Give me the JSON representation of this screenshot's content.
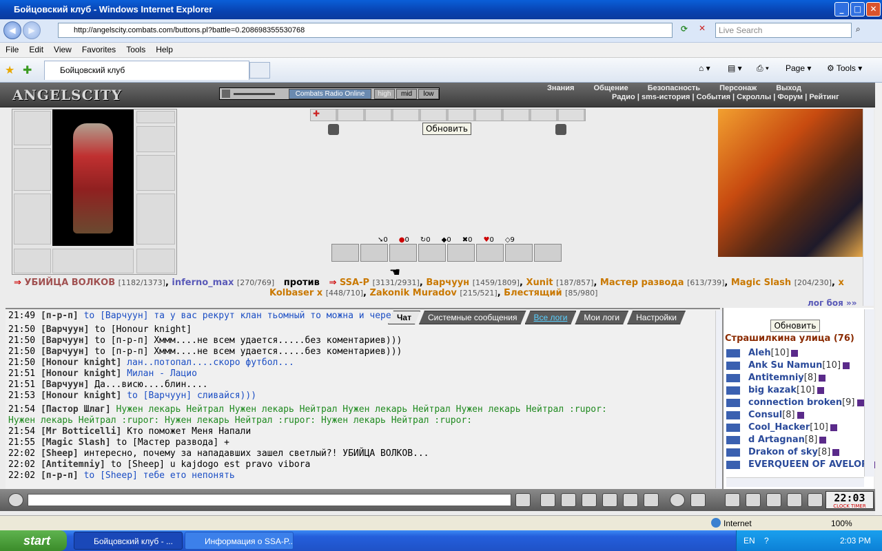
{
  "window": {
    "title": "Бойцовский клуб - Windows Internet Explorer"
  },
  "address": {
    "url": "http://angelscity.combats.com/buttons.pl?battle=0.208698355530768",
    "search_placeholder": "Live Search"
  },
  "menu": [
    "File",
    "Edit",
    "View",
    "Favorites",
    "Tools",
    "Help"
  ],
  "tab": {
    "title": "Бойцовский клуб"
  },
  "toolbar": {
    "page": "Page",
    "tools": "Tools"
  },
  "game": {
    "logo": "ANGELSCITY",
    "radio": {
      "name": "Combats Radio Online",
      "high": "high",
      "mid": "mid",
      "low": "low"
    },
    "topnav": [
      "Знания",
      "Общение",
      "Безопасность",
      "Персонаж",
      "Выход"
    ],
    "subnav": "Радио | sms-история | События | Скроллы | Форум | Рейтинг",
    "refresh": "Обновить",
    "stats": [
      "0",
      "0",
      "0",
      "0",
      "0",
      "0",
      "9"
    ],
    "battle": {
      "team1": [
        {
          "name": "УБИЙЦА ВОЛКОВ",
          "hp": "[1182/1373]"
        },
        {
          "name": "inferno_max",
          "hp": "[270/769]"
        }
      ],
      "vs": "против",
      "team2": [
        {
          "name": "SSA-P",
          "hp": "[3131/2931]"
        },
        {
          "name": "Варчуун",
          "hp": "[1459/1809]"
        },
        {
          "name": "Xunit",
          "hp": "[187/857]"
        },
        {
          "name": "Мастер развода",
          "hp": "[613/739]"
        },
        {
          "name": "Magic Slash",
          "hp": "[204/230]"
        },
        {
          "name": "x",
          "hp": ""
        },
        {
          "name": "Kolbaser x",
          "hp": "[448/710]"
        },
        {
          "name": "Zakonik Muradov",
          "hp": "[215/521]"
        },
        {
          "name": "Блестящий",
          "hp": "[85/980]"
        }
      ],
      "log_link": "лог боя »»"
    }
  },
  "chat": {
    "tabs": [
      "Чат",
      "Системные сообщения",
      "Все логи",
      "Мои логи",
      "Настройки"
    ],
    "lines": [
      {
        "t": "21:49",
        "n": "[п-р-п]",
        "m": " to [Варчуун] та у вас рекрут клан тьомный то можна и через ре",
        "c": "bl"
      },
      {
        "t": "21:50",
        "n": "[Варчуун]",
        "m": " to [Honour knight]",
        "c": ""
      },
      {
        "t": "21:50",
        "n": "[Варчуун]",
        "m": " to [п-р-п] Хммм....не всем удается.....без коментариев)))",
        "c": ""
      },
      {
        "t": "21:50",
        "n": "[Варчуун]",
        "m": " to [п-р-п] Хммм....не всем удается.....без коментариев)))",
        "c": ""
      },
      {
        "t": "21:50",
        "n": "[Honour knight]",
        "m": " лан..потопал....скоро футбол...",
        "c": "bl"
      },
      {
        "t": "21:51",
        "n": "[Honour knight]",
        "m": " Милан - Лацио",
        "c": "bl"
      },
      {
        "t": "21:51",
        "n": "[Варчуун]",
        "m": " Да...висю....блин....",
        "c": ""
      },
      {
        "t": "21:53",
        "n": "[Honour knight]",
        "m": " to [Варчуун] сливайся)))",
        "c": "bl"
      },
      {
        "t": "21:54",
        "n": "[Пастор Шлаг]",
        "m": " Нужен лекарь Нейтрал      Нужен лекарь Нейтрал      Нужен лекарь Нейтрал      Нужен лекарь Нейтрал :rupor:",
        "c": "gr"
      },
      {
        "t": "",
        "n": "",
        "m": "Нужен лекарь Нейтрал :rupor: Нужен лекарь Нейтрал :rupor: Нужен лекарь Нейтрал :rupor:",
        "c": "gr"
      },
      {
        "t": "21:54",
        "n": "[Mr Botticelli]",
        "m": " Кто поможет Меня Напали",
        "c": ""
      },
      {
        "t": "21:55",
        "n": "[Magic Slash]",
        "m": " to [Мастер развода] +",
        "c": ""
      },
      {
        "t": "22:02",
        "n": "[Sheep]",
        "m": " интересно, почему за нападавших зашел светлый?! УБИЙЦА ВОЛКОВ...",
        "c": ""
      },
      {
        "t": "22:02",
        "n": "[Antitemniy]",
        "m": " to [Sheep] u kajdogo est pravo vibora",
        "c": ""
      },
      {
        "t": "22:02",
        "n": "[п-р-п]",
        "m": " to [Sheep] тебе ето непонять",
        "c": "bl"
      }
    ]
  },
  "online": {
    "refresh": "Обновить",
    "location": "Страшилкина улица (76)",
    "users": [
      {
        "name": "Aleh",
        "lvl": "[10]"
      },
      {
        "name": "Ank Su Namun",
        "lvl": "[10]"
      },
      {
        "name": "Antitemniy",
        "lvl": "[8]"
      },
      {
        "name": "big kazak",
        "lvl": "[10]"
      },
      {
        "name": "connection broken",
        "lvl": "[9]"
      },
      {
        "name": "Consul",
        "lvl": "[8]"
      },
      {
        "name": "Cool_Hacker",
        "lvl": "[10]"
      },
      {
        "name": "d Artagnan",
        "lvl": "[8]"
      },
      {
        "name": "Drakon of sky",
        "lvl": "[8]"
      },
      {
        "name": "EVERQUEEN OF AVELOR",
        "lvl": ""
      }
    ]
  },
  "clock": {
    "time": "22:03",
    "label": "CLOCK TIMER"
  },
  "status": {
    "zone": "Internet",
    "zoom": "100%"
  },
  "taskbar": {
    "start": "start",
    "tasks": [
      "Бойцовский клуб - ...",
      "Информация о SSA-P..."
    ],
    "lang": "EN",
    "time": "2:03 PM"
  }
}
